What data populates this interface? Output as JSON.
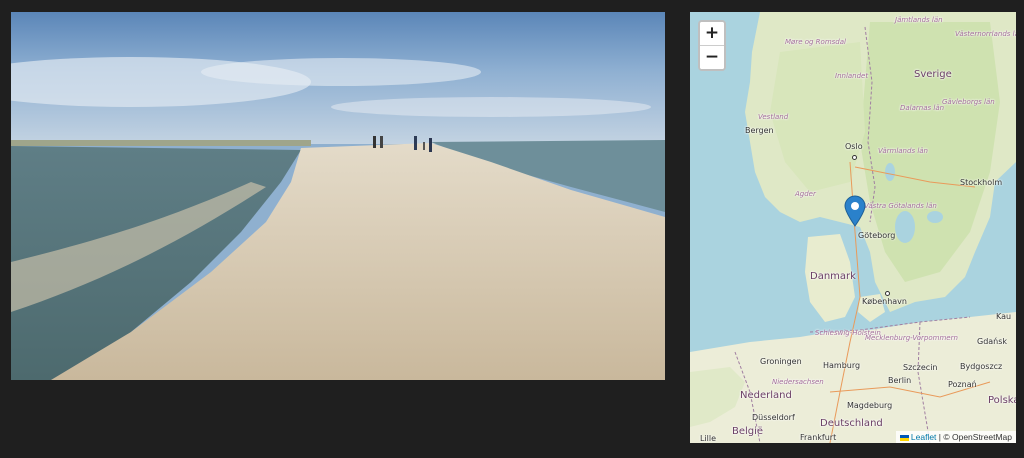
{
  "photo": {
    "description_icon": "beach-photo"
  },
  "map": {
    "zoom_in_label": "+",
    "zoom_out_label": "−",
    "attribution": {
      "leaflet": "Leaflet",
      "separator": " | © ",
      "osm": "OpenStreetMap"
    },
    "labels": {
      "jamtlands": "Jämtlands län",
      "more": "Møre og Romsdal",
      "vasternorrlands": "Västernorrlands län",
      "sverige": "Sverige",
      "innlandet": "Innlandet",
      "dalarnas": "Dalarnas län",
      "vestland": "Vestland",
      "gavleborgs": "Gävleborgs län",
      "bergen": "Bergen",
      "oslo": "Oslo",
      "varmlands": "Värmlands län",
      "stockholm": "Stockholm",
      "agder": "Agder",
      "vastra": "Västra Götalands län",
      "goteborg": "Göteborg",
      "danmark": "Danmark",
      "kobenhavn": "København",
      "schleswig": "Schleswig-Holstein",
      "mecklenburg": "Mecklenburg-Vorpommern",
      "kaunas": "Kau",
      "groningen": "Groningen",
      "hamburg": "Hamburg",
      "szczecin": "Szczecin",
      "bydgoszcz": "Bydgoszcz",
      "gdansk": "Gdańsk",
      "niedersachsen": "Niedersachsen",
      "berlin": "Berlin",
      "poznan": "Poznań",
      "nederland": "Nederland",
      "polska": "Polska",
      "dusseldorf": "Düsseldorf",
      "magdeburg": "Magdeburg",
      "belgie": "België",
      "deutschland": "Deutschland",
      "lille": "Lille",
      "frankfurt": "Frankfurt"
    }
  }
}
